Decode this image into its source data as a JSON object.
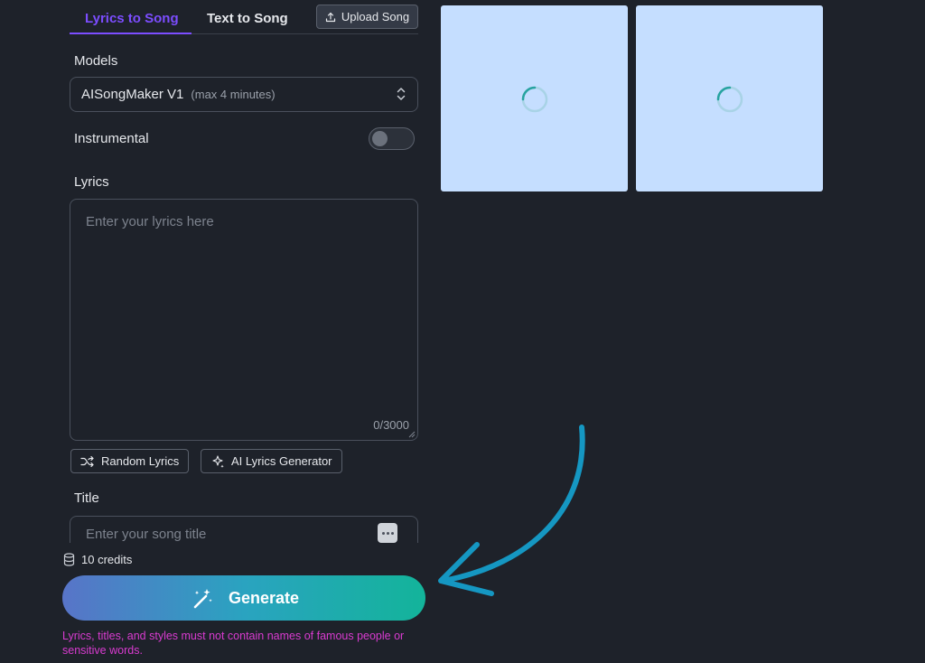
{
  "tabs": [
    {
      "label": "Lyrics to Song",
      "active": true
    },
    {
      "label": "Text to Song",
      "active": false
    }
  ],
  "upload_button": {
    "label": "Upload Song",
    "icon": "upload-icon"
  },
  "models": {
    "label": "Models",
    "selected": "AISongMaker V1",
    "hint": "(max 4 minutes)"
  },
  "instrumental": {
    "label": "Instrumental",
    "enabled": false
  },
  "lyrics": {
    "label": "Lyrics",
    "placeholder": "Enter your lyrics here",
    "counter": "0/3000"
  },
  "lyrics_actions": [
    {
      "label": "Random Lyrics",
      "icon": "shuffle-icon"
    },
    {
      "label": "AI Lyrics Generator",
      "icon": "sparkles-icon"
    }
  ],
  "title": {
    "label": "Title",
    "placeholder": "Enter your song title"
  },
  "credits": {
    "text": "10 credits",
    "icon": "coins-icon"
  },
  "generate_button": {
    "label": "Generate",
    "icon": "magic-wand-icon"
  },
  "warning": "Lyrics, titles, and styles must not contain names of famous people or sensitive words.",
  "colors": {
    "background": "#1e222a",
    "accent": "#7c4dff",
    "warning": "#d93bd0",
    "card": "#c5deff",
    "arrow": "#1597c2",
    "generate_gradient": [
      "#5874c8",
      "#13b49a"
    ]
  }
}
